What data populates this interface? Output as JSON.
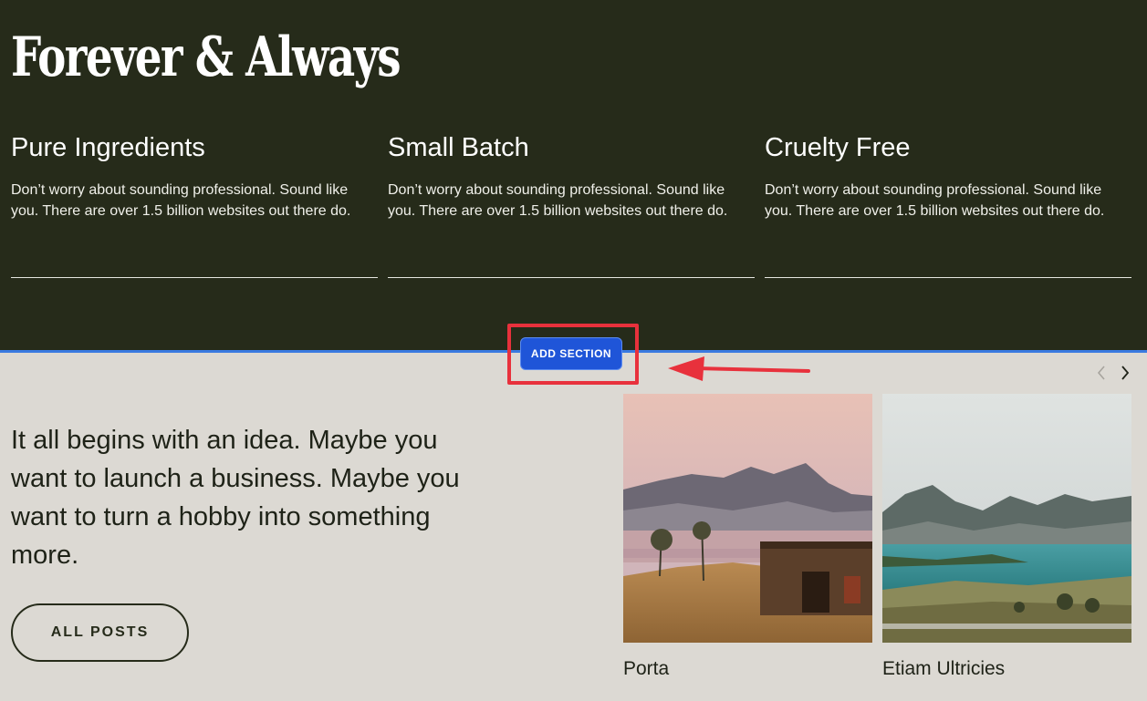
{
  "header": {
    "brand": "Forever & Always"
  },
  "features": [
    {
      "title": "Pure Ingredients",
      "body": "Don’t worry about sounding professional. Sound like you. There are over 1.5 billion websites out there do."
    },
    {
      "title": "Small Batch",
      "body": "Don’t worry about sounding professional. Sound like you. There are over 1.5 billion websites out there do."
    },
    {
      "title": "Cruelty Free",
      "body": "Don’t worry about sounding professional. Sound like you. There are over 1.5 billion websites out there do."
    }
  ],
  "editor": {
    "add_section_label": "ADD SECTION",
    "accent_color": "#1f55d8",
    "highlight_color": "#e8313c"
  },
  "blog": {
    "lede": "It all begins with an idea. Maybe you want to launch a business. Maybe you want to turn a hobby into something more.",
    "all_posts_label": "ALL POSTS",
    "prev_icon": "chevron-left-icon",
    "next_icon": "chevron-right-icon",
    "posts": [
      {
        "title": "Porta"
      },
      {
        "title": "Etiam Ultricies"
      }
    ]
  }
}
